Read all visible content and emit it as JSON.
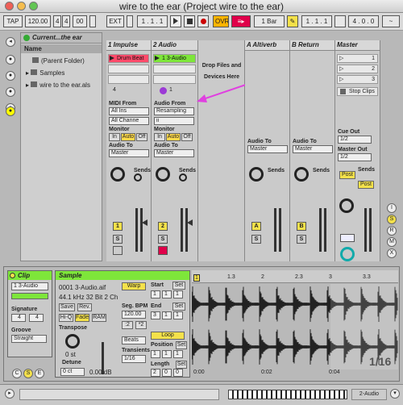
{
  "window": {
    "title": "wire to the ear (Project wire to the ear)"
  },
  "toolbar": {
    "tap": "TAP",
    "tempo": "120.00",
    "sig_num": "4",
    "sig_den": "4",
    "loop_label": "00",
    "ext": "EXT",
    "position": "1 . 1 . 1",
    "ovr": "OVR",
    "quantize": "1 Bar",
    "pos2": "1 . 1 . 1",
    "pos3": "4 . 0 . 0"
  },
  "browser": {
    "location": "Current...the ear",
    "column": "Name",
    "items": [
      "(Parent Folder)",
      "Samples",
      "wire to the ear.als"
    ]
  },
  "tracks": [
    {
      "name": "1 Impulse",
      "clip": "Drum Beat",
      "input_label": "MIDI From",
      "input": "All Ins",
      "channel": "All Channe",
      "monitor_label": "Monitor",
      "mon": [
        "In",
        "Auto",
        "Off"
      ],
      "out_label": "Audio To",
      "out": "Master",
      "sends": "Sends",
      "num": "1",
      "arm_letter": "S"
    },
    {
      "name": "2 Audio",
      "clip": "1 3-Audio",
      "input_label": "Audio From",
      "input": "Resampling",
      "channel": "ii",
      "monitor_label": "Monitor",
      "mon": [
        "In",
        "Auto",
        "Off"
      ],
      "out_label": "Audio To",
      "out": "Master",
      "sends": "Sends",
      "num": "2",
      "arm_letter": "S"
    },
    {
      "name": "A Altiverb",
      "out_label": "Audio To",
      "out": "Master",
      "sends": "Sends",
      "num": "A",
      "arm_letter": "S"
    },
    {
      "name": "B Return",
      "out_label": "Audio To",
      "out": "Master",
      "sends": "Sends",
      "num": "B",
      "arm_letter": "S"
    }
  ],
  "master": {
    "name": "Master",
    "scenes": [
      "1",
      "2",
      "3"
    ],
    "stop": "Stop Clips",
    "cue_label": "Cue Out",
    "cue": "1/2",
    "out_label": "Master Out",
    "out": "1/2",
    "sends": "Sends",
    "post1": "Post",
    "post2": "Post"
  },
  "dropzone": "Drop Files and Devices Here",
  "count4": "4",
  "count1": "1",
  "clip": {
    "title": "Clip",
    "name": "1 3-Audio",
    "sig_label": "Signature",
    "sig_num": "4",
    "sig_den": "4",
    "groove_label": "Groove",
    "groove": "Straight"
  },
  "sample": {
    "title": "Sample",
    "file": "0001 3-Audio.aif",
    "info": "44.1 kHz 32 Bit 2 Ch",
    "save": "Save",
    "rev": "Rev.",
    "hiq": "Hi-Q",
    "fade": "Fade",
    "ram": "RAM",
    "transpose_label": "Transpose",
    "transpose": "0 st",
    "detune_label": "Detune",
    "detune": "0 ct",
    "gain": "0.00 dB",
    "warp": "Warp",
    "seg_label": "Seg. BPM",
    "seg": "120.00",
    "half": ":2",
    "double": "*2",
    "beats": "Beats",
    "transients_label": "Transients",
    "transients": "1/16",
    "start_label": "Start",
    "end_label": "End",
    "set": "Set",
    "loop": "Loop",
    "pos_label": "Position",
    "len_label": "Length",
    "start": [
      "1",
      "1",
      "1"
    ],
    "end": [
      "3",
      "1",
      "1"
    ],
    "position": [
      "1",
      "1",
      "1"
    ],
    "length": [
      "2",
      "0",
      "0"
    ]
  },
  "waveform": {
    "ruler": [
      "1",
      "1.3",
      "2",
      "2.3",
      "3",
      "3.3"
    ],
    "times": [
      "0:00",
      "0:02",
      "0:04"
    ],
    "zoom": "1/16"
  },
  "status": {
    "track": "2-Audio"
  }
}
